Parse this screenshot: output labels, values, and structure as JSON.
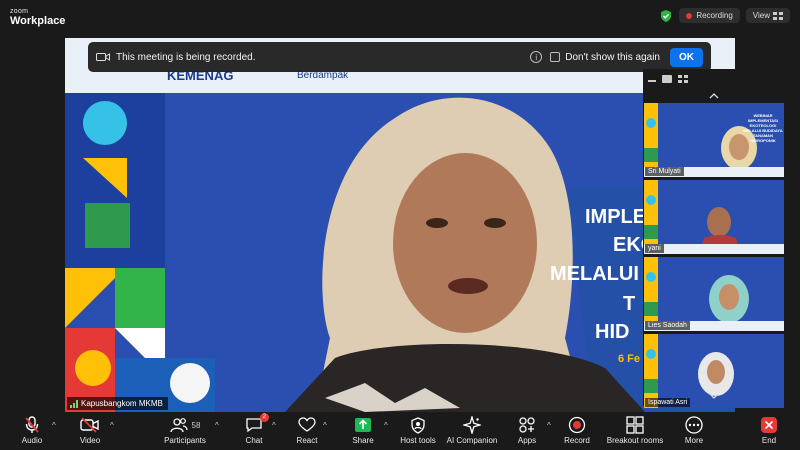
{
  "app": {
    "brand_line1": "zoom",
    "brand_line2": "Workplace"
  },
  "status": {
    "recording_label": "Recording",
    "view_label": "View"
  },
  "banner": {
    "message": "This meeting is being recorded.",
    "checkbox_label": "Don't show this again",
    "ok_label": "OK"
  },
  "main_video": {
    "speaker_name": "Kapusbangkom MKMB",
    "backdrop_texts": [
      "KEMENAG",
      "Berdampak",
      "IMPLE",
      "EKO",
      "MELALUI B",
      "T",
      "HID",
      "6 Fe"
    ]
  },
  "gallery": {
    "participants": [
      {
        "name": "Sri Mulyati"
      },
      {
        "name": "yani"
      },
      {
        "name": "Lies Saodah"
      },
      {
        "name": "Ispawati Asri"
      }
    ],
    "thumb_backdrop_texts": [
      "WEBINAR",
      "IMPLEMENTASI",
      "EKOTEOLOGI",
      "MELALUI BUDIDAYA",
      "TANAMAN",
      "HIDROPONIK"
    ]
  },
  "toolbar": {
    "audio": "Audio",
    "video": "Video",
    "participants": "Participants",
    "participants_count": "58",
    "chat": "Chat",
    "chat_badge": "2",
    "react": "React",
    "share": "Share",
    "host_tools": "Host tools",
    "ai_companion": "AI Companion",
    "apps": "Apps",
    "record": "Record",
    "breakout_rooms": "Breakout rooms",
    "more": "More",
    "end": "End"
  },
  "colors": {
    "accent": "#0e72ed",
    "danger": "#e53935",
    "shield": "#2fb344",
    "share": "#1db954",
    "backdrop": "#2a4fb0"
  }
}
